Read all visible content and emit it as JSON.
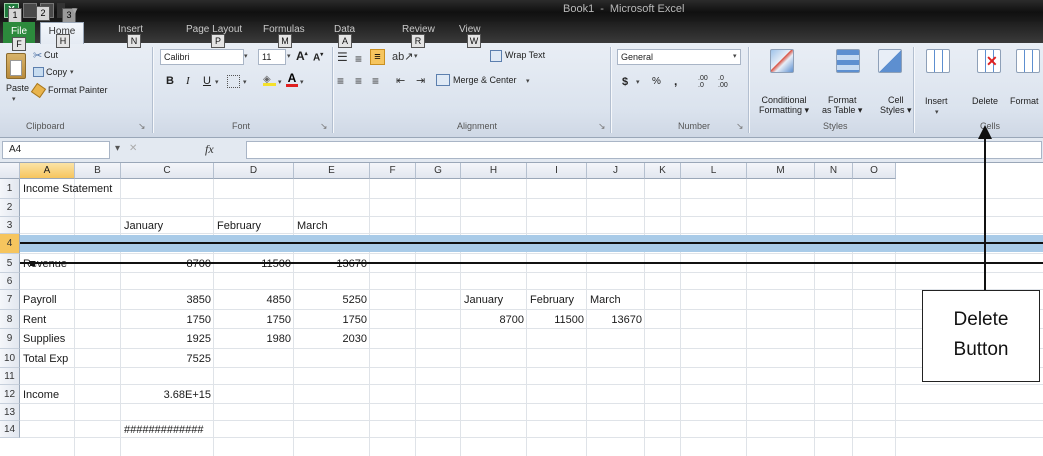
{
  "window": {
    "app_title": "Book1",
    "title_sep": "-",
    "app_name": "Microsoft Excel",
    "qat_keytips": [
      "1",
      "2",
      "3"
    ]
  },
  "ribbon_tabs": [
    {
      "label": "File",
      "keytip": "F"
    },
    {
      "label": "Home",
      "keytip": "H"
    },
    {
      "label": "Insert",
      "keytip": "N"
    },
    {
      "label": "Page Layout",
      "keytip": "P"
    },
    {
      "label": "Formulas",
      "keytip": "M"
    },
    {
      "label": "Data",
      "keytip": "A"
    },
    {
      "label": "Review",
      "keytip": "R"
    },
    {
      "label": "View",
      "keytip": "W"
    }
  ],
  "ribbon": {
    "clipboard": {
      "paste": "Paste",
      "cut": "Cut",
      "copy": "Copy",
      "format_painter": "Format Painter",
      "group_label": "Clipboard"
    },
    "font": {
      "font_name": "Calibri",
      "font_size": "11",
      "bold": "B",
      "italic": "I",
      "underline": "U",
      "group_label": "Font"
    },
    "alignment": {
      "wrap_text": "Wrap Text",
      "merge_center": "Merge & Center",
      "group_label": "Alignment"
    },
    "number": {
      "format": "General",
      "currency": "$",
      "percent": "%",
      "comma": ",",
      "inc_decimal": ".00",
      "dec_decimal": ".0",
      "group_label": "Number"
    },
    "styles": {
      "conditional_formatting": [
        "Conditional",
        "Formatting"
      ],
      "format_as_table": [
        "Format",
        "as Table"
      ],
      "cell_styles": [
        "Cell",
        "Styles"
      ],
      "group_label": "Styles"
    },
    "cells": {
      "insert": "Insert",
      "delete": "Delete",
      "format": "Format",
      "group_label": "Cells"
    }
  },
  "formula_bar": {
    "name_box": "A4",
    "fx": "fx",
    "content": ""
  },
  "columns": [
    "A",
    "B",
    "C",
    "D",
    "E",
    "F",
    "G",
    "H",
    "I",
    "J",
    "K",
    "L",
    "M",
    "N",
    "O"
  ],
  "selected_column": "A",
  "rows": [
    "1",
    "2",
    "3",
    "4",
    "5",
    "6",
    "7",
    "8",
    "9",
    "10",
    "11",
    "12",
    "13",
    "14"
  ],
  "selected_row": "4",
  "cells": [
    {
      "ref": "A1",
      "value": "Income Statement"
    },
    {
      "ref": "C3",
      "value": "January"
    },
    {
      "ref": "D3",
      "value": "February"
    },
    {
      "ref": "E3",
      "value": "March"
    },
    {
      "ref": "A5",
      "value": "Revenue"
    },
    {
      "ref": "C5",
      "value": "8700"
    },
    {
      "ref": "D5",
      "value": "11500"
    },
    {
      "ref": "E5",
      "value": "13670"
    },
    {
      "ref": "A7",
      "value": "Payroll"
    },
    {
      "ref": "C7",
      "value": "3850"
    },
    {
      "ref": "D7",
      "value": "4850"
    },
    {
      "ref": "E7",
      "value": "5250"
    },
    {
      "ref": "H7",
      "value": "January"
    },
    {
      "ref": "I7",
      "value": "February"
    },
    {
      "ref": "J7",
      "value": "March"
    },
    {
      "ref": "A8",
      "value": "Rent"
    },
    {
      "ref": "C8",
      "value": "1750"
    },
    {
      "ref": "D8",
      "value": "1750"
    },
    {
      "ref": "E8",
      "value": "1750"
    },
    {
      "ref": "H8",
      "value": "8700"
    },
    {
      "ref": "I8",
      "value": "11500"
    },
    {
      "ref": "J8",
      "value": "13670"
    },
    {
      "ref": "A9",
      "value": "Supplies"
    },
    {
      "ref": "C9",
      "value": "1925"
    },
    {
      "ref": "D9",
      "value": "1980"
    },
    {
      "ref": "E9",
      "value": "2030"
    },
    {
      "ref": "A10",
      "value": "Total Exp"
    },
    {
      "ref": "C10",
      "value": "7525"
    },
    {
      "ref": "A12",
      "value": "Income"
    },
    {
      "ref": "C12",
      "value": "3.68E+15"
    },
    {
      "ref": "C14",
      "value": "#############"
    }
  ],
  "callout": {
    "line1": "Delete",
    "line2": "Button"
  }
}
